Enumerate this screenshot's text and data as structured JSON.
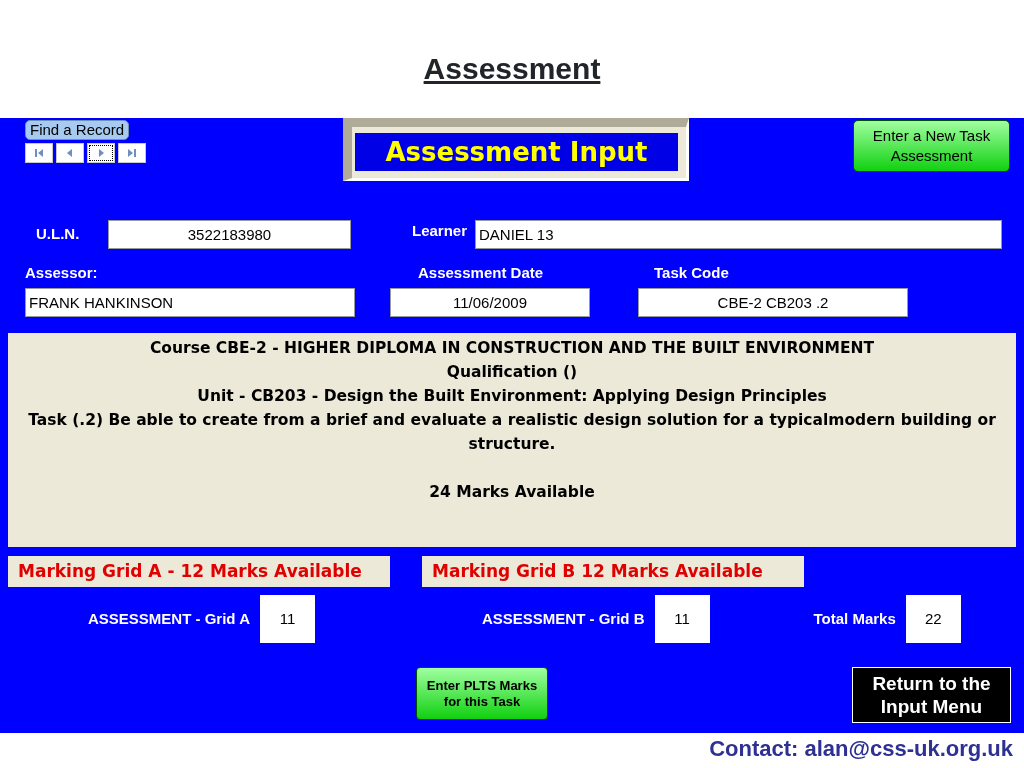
{
  "slide_title": "Assessment",
  "form": {
    "find_record": {
      "label": "Find a Record",
      "nav_buttons": [
        {
          "kind": "first",
          "focused": false
        },
        {
          "kind": "previous",
          "focused": false
        },
        {
          "kind": "next",
          "focused": true
        },
        {
          "kind": "last",
          "focused": false
        }
      ]
    },
    "title": "Assessment Input",
    "new_task_button": "Enter a New Task Assessment",
    "fields": [
      {
        "label": "U.L.N.",
        "value": "3522183980"
      },
      {
        "label": "Learner",
        "value": "DANIEL 13"
      },
      {
        "label": "Assessor:",
        "value": "FRANK HANKINSON"
      },
      {
        "label": "Assessment Date",
        "value": "11/06/2009"
      },
      {
        "label": "Task Code",
        "value": "CBE-2 CB203 .2"
      }
    ],
    "description": [
      {
        "text": "Course CBE-2 - HIGHER DIPLOMA IN CONSTRUCTION AND THE BUILT ENVIRONMENT"
      },
      {
        "text": "Qualification ()"
      },
      {
        "text": "Unit - CB203 - Design the Built Environment: Applying Design Principles"
      },
      {
        "text": "Task (.2) Be able to create from a brief and evaluate a realistic design solution for a typicalmodern building or structure."
      },
      {
        "text": "24 Marks Available"
      }
    ],
    "grid_headings": [
      "Marking Grid A - 12 Marks Available",
      "Marking Grid B 12 Marks Available"
    ],
    "marks": [
      {
        "label": "ASSESSMENT - Grid A",
        "value": "11"
      },
      {
        "label": "ASSESSMENT - Grid B",
        "value": "11"
      },
      {
        "label": "Total Marks",
        "value": "22"
      }
    ],
    "plts_button": "Enter PLTS Marks for this Task",
    "return_button": "Return to the Input Menu"
  },
  "contact": "Contact: alan@css-uk.org.uk"
}
